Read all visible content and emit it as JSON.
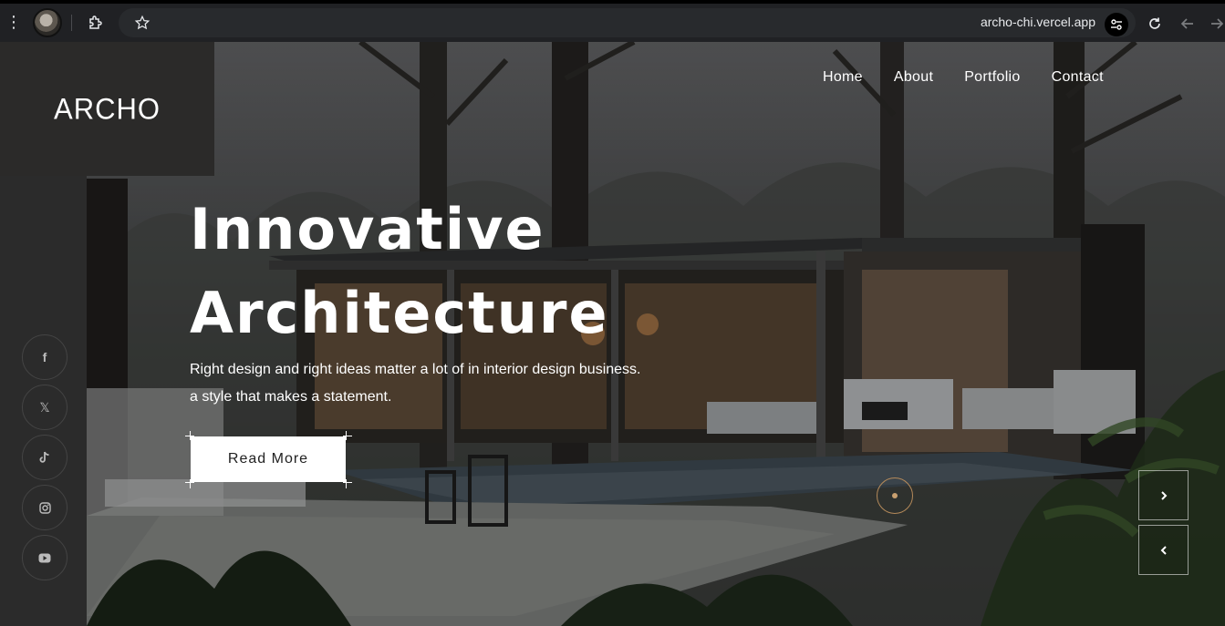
{
  "browser": {
    "url": "archo-chi.vercel.app"
  },
  "site": {
    "logo": "ARCHO",
    "nav": [
      "Home",
      "About",
      "Portfolio",
      "Contact"
    ]
  },
  "hero": {
    "title_line1": "Innovative",
    "title_line2": "Architecture",
    "subtitle_line1": "Right design and right ideas matter a lot of in interior design business.",
    "subtitle_line2": "a style that makes a statement.",
    "cta_label": "Read More"
  },
  "social": [
    "facebook-icon",
    "x-icon",
    "tiktok-icon",
    "instagram-icon",
    "youtube-icon"
  ],
  "colors": {
    "accent": "#c9a070",
    "sidebar": "#2b2b2b",
    "button_bg": "#ffffff"
  }
}
